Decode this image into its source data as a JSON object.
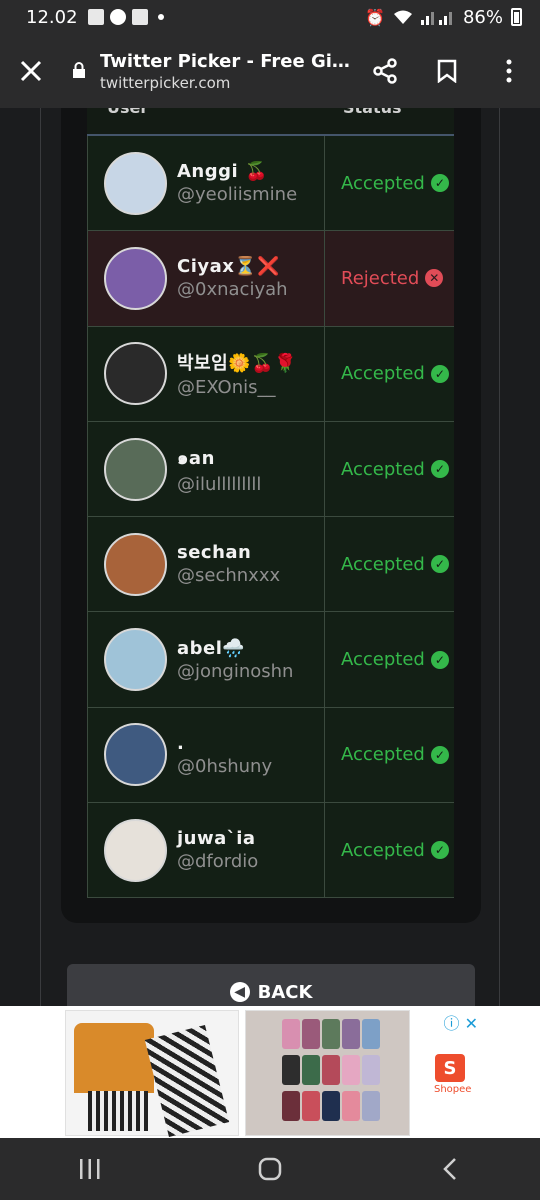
{
  "status_bar": {
    "time": "12.02",
    "battery": "86%"
  },
  "browser": {
    "title": "Twitter Picker - Free Give...",
    "host": "twitterpicker.com"
  },
  "table": {
    "headers": [
      "User",
      "Status"
    ],
    "rows": [
      {
        "name": "Anggi 🍒",
        "handle": "@yeoliismine",
        "status": "Accepted",
        "state": "accepted",
        "avatar_color": "#c7d6e6"
      },
      {
        "name": "Ciyax⏳❌",
        "handle": "@0xnaciyah",
        "status": "Rejected",
        "state": "rejected",
        "avatar_color": "#7b5ea8"
      },
      {
        "name": "박보임🌼🍒🌹",
        "handle": "@EXOnis__",
        "status": "Accepted",
        "state": "accepted",
        "avatar_color": "#2a2a2a"
      },
      {
        "name": "๑an",
        "handle": "@ilulllllllll",
        "status": "Accepted",
        "state": "accepted",
        "avatar_color": "#586b58"
      },
      {
        "name": "sechan",
        "handle": "@sechnxxx",
        "status": "Accepted",
        "state": "accepted",
        "avatar_color": "#a8633a"
      },
      {
        "name": "abel🌧️",
        "handle": "@jonginoshn",
        "status": "Accepted",
        "state": "accepted",
        "avatar_color": "#9fc3d8"
      },
      {
        "name": ".",
        "handle": "@0hshuny",
        "status": "Accepted",
        "state": "accepted",
        "avatar_color": "#3f5a80"
      },
      {
        "name": "juwa`ia",
        "handle": "@dfordio",
        "status": "Accepted",
        "state": "accepted",
        "avatar_color": "#e6e1da"
      }
    ]
  },
  "back_label": "BACK",
  "ad": {
    "brand": "Shopee"
  },
  "colors": {
    "accepted": "#34b84a",
    "rejected": "#e14c57"
  }
}
